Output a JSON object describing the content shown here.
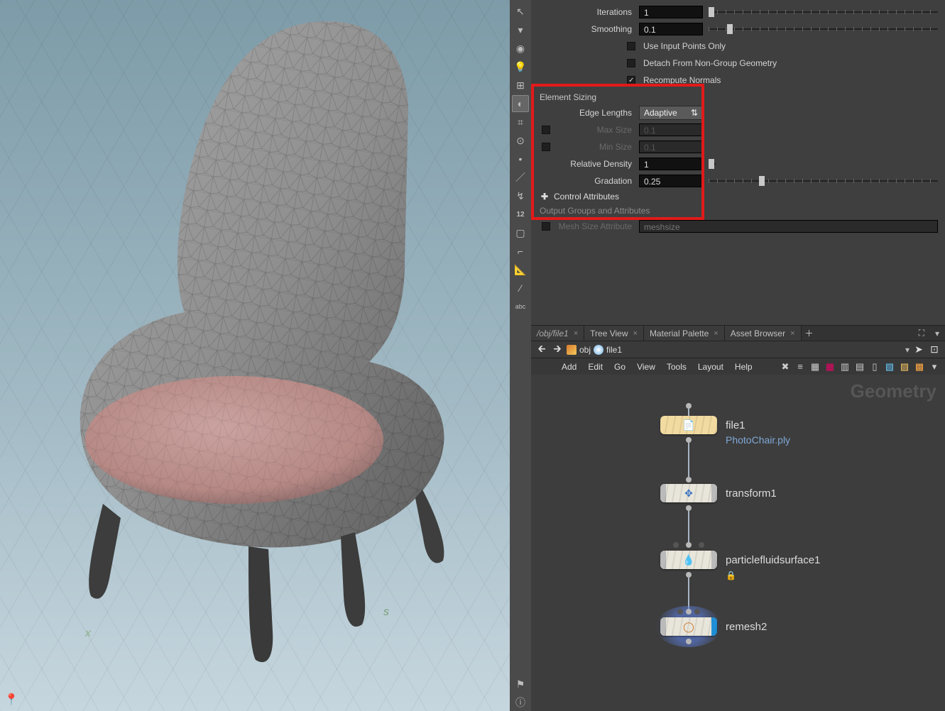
{
  "params": {
    "iterations": {
      "label": "Iterations",
      "value": "1"
    },
    "smoothing": {
      "label": "Smoothing",
      "value": "0.1"
    },
    "useInputPoints": {
      "label": "Use Input Points Only",
      "checked": false
    },
    "detach": {
      "label": "Detach From Non-Group Geometry",
      "checked": false
    },
    "recompute": {
      "label": "Recompute Normals",
      "checked": true
    },
    "elementSizing": "Element Sizing",
    "edgeLengths": {
      "label": "Edge Lengths",
      "value": "Adaptive"
    },
    "maxSize": {
      "label": "Max Size",
      "value": "0.1"
    },
    "minSize": {
      "label": "Min Size",
      "value": "0.1"
    },
    "relDensity": {
      "label": "Relative Density",
      "value": "1"
    },
    "gradation": {
      "label": "Gradation",
      "value": "0.25"
    },
    "controlAttributes": "Control Attributes",
    "outputGroups": "Output Groups and Attributes",
    "meshSizeAttr": {
      "label": "Mesh Size Attribute",
      "value": "meshsize"
    }
  },
  "tabs": {
    "t0": "/obj/file1",
    "t1": "Tree View",
    "t2": "Material Palette",
    "t3": "Asset Browser"
  },
  "path": {
    "seg1": "obj",
    "seg2": "file1"
  },
  "menu": {
    "add": "Add",
    "edit": "Edit",
    "go": "Go",
    "view": "View",
    "tools": "Tools",
    "layout": "Layout",
    "help": "Help"
  },
  "network": {
    "watermark": "Geometry",
    "n1": {
      "label": "file1",
      "sub": "PhotoChair.ply"
    },
    "n2": {
      "label": "transform1"
    },
    "n3": {
      "label": "particlefluidsurface1"
    },
    "n4": {
      "label": "remesh2"
    }
  },
  "toolstripLabel": "abc"
}
